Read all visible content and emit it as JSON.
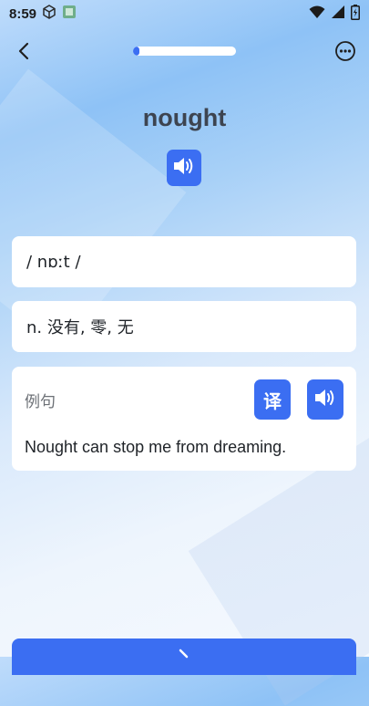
{
  "status_bar": {
    "time": "8:59"
  },
  "nav": {
    "progress_fraction": 0.06
  },
  "word": {
    "text": "nought"
  },
  "phonetic": {
    "text": "/  nɒːt  /"
  },
  "meaning": {
    "text": "n. 没有, 零, 无"
  },
  "example": {
    "label": "例句",
    "translate_label": "译",
    "sentence": "Nought can stop me from dreaming."
  },
  "colors": {
    "accent": "#3b6ef2",
    "card_background": "#ffffff"
  },
  "icons": {
    "back": "chevron-left-icon",
    "more": "more-options-icon",
    "speaker": "speaker-icon",
    "next": "chevron-right-icon"
  }
}
